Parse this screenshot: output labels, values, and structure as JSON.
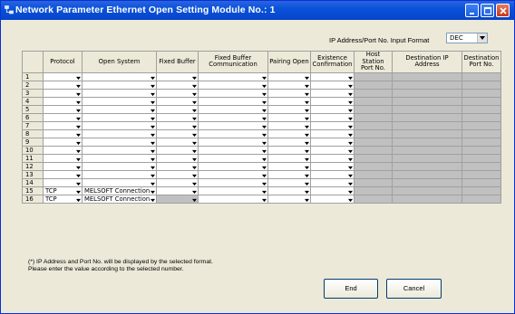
{
  "window": {
    "title": "Network Parameter  Ethernet Open Setting Module No.: 1",
    "title_color": "#0a52db"
  },
  "format": {
    "label": "IP Address/Port No. Input Format",
    "selected": "DEC"
  },
  "table": {
    "headers": [
      "",
      "Protocol",
      "Open System",
      "Fixed Buffer",
      "Fixed Buffer Communication",
      "Pairing Open",
      "Existence Confirmation",
      "Host Station Port No.",
      "Destination IP Address",
      "Destination Port No."
    ],
    "rows": [
      {
        "no": "1",
        "protocol": "",
        "open_system": ""
      },
      {
        "no": "2",
        "protocol": "",
        "open_system": ""
      },
      {
        "no": "3",
        "protocol": "",
        "open_system": ""
      },
      {
        "no": "4",
        "protocol": "",
        "open_system": ""
      },
      {
        "no": "5",
        "protocol": "",
        "open_system": ""
      },
      {
        "no": "6",
        "protocol": "",
        "open_system": ""
      },
      {
        "no": "7",
        "protocol": "",
        "open_system": ""
      },
      {
        "no": "8",
        "protocol": "",
        "open_system": ""
      },
      {
        "no": "9",
        "protocol": "",
        "open_system": ""
      },
      {
        "no": "10",
        "protocol": "",
        "open_system": ""
      },
      {
        "no": "11",
        "protocol": "",
        "open_system": ""
      },
      {
        "no": "12",
        "protocol": "",
        "open_system": ""
      },
      {
        "no": "13",
        "protocol": "",
        "open_system": ""
      },
      {
        "no": "14",
        "protocol": "",
        "open_system": ""
      },
      {
        "no": "15",
        "protocol": "TCP",
        "open_system": "MELSOFT Connection"
      },
      {
        "no": "16",
        "protocol": "TCP",
        "open_system": "MELSOFT Connection"
      }
    ]
  },
  "note": {
    "line1": "(*) IP Address and Port No. will be displayed by the selected format.",
    "line2": "Please enter the value according to the selected number."
  },
  "buttons": {
    "end": "End",
    "cancel": "Cancel"
  },
  "icons": {
    "app": "network-app-icon",
    "dropdown": "chevron-down-icon"
  }
}
